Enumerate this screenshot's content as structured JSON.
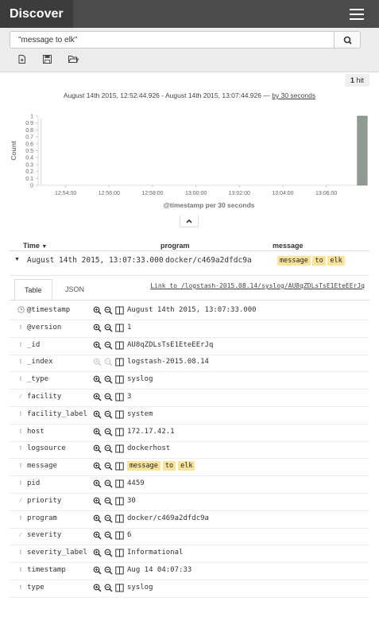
{
  "header": {
    "title": "Discover"
  },
  "search": {
    "value": "\"message to elk\""
  },
  "hits": {
    "count": "1",
    "label": "hit"
  },
  "chart_header": {
    "range": "August 14th 2015, 12:52:44.926 - August 14th 2015, 13:07:44.926",
    "sep": "—",
    "interval": "by 30 seconds"
  },
  "chart_data": {
    "type": "bar",
    "ylabel": "Count",
    "xlabel": "@timestamp per 30 seconds",
    "yticks": [
      "0",
      "0.1",
      "0.2",
      "0.3",
      "0.4",
      "0.5",
      "0.6",
      "0.7",
      "0.8",
      "0.9",
      "1"
    ],
    "ylim": [
      0,
      1
    ],
    "xticks": [
      "12:54:00",
      "12:56:00",
      "12:58:00",
      "13:00:00",
      "13:02:00",
      "13:04:00",
      "13:06:00"
    ],
    "series": [
      {
        "x": [
          "13:07:30"
        ],
        "values": [
          1
        ]
      }
    ]
  },
  "table": {
    "columns": [
      "Time",
      "program",
      "message"
    ],
    "row": {
      "time": "August 14th 2015, 13:07:33.000",
      "program": "docker/c469a2dfdc9a",
      "message": [
        "message",
        "to",
        "elk"
      ]
    }
  },
  "details": {
    "tabs": [
      "Table",
      "JSON"
    ],
    "link": "Link to /logstash-2015.08.14/syslog/AU8qZDLsTsE1EteEErJq",
    "fields": [
      {
        "type": "clock",
        "name": "@timestamp",
        "value": "August 14th 2015, 13:07:33.000"
      },
      {
        "type": "t",
        "name": "@version",
        "value": "1"
      },
      {
        "type": "t",
        "name": "_id",
        "value": "AU8qZDLsTsE1EteEErJq"
      },
      {
        "type": "t",
        "name": "_index",
        "value": "logstash-2015.08.14"
      },
      {
        "type": "t",
        "name": "_type",
        "value": "syslog"
      },
      {
        "type": "#",
        "name": "facility",
        "value": "3"
      },
      {
        "type": "t",
        "name": "facility_label",
        "value": "system"
      },
      {
        "type": "t",
        "name": "host",
        "value": "172.17.42.1"
      },
      {
        "type": "t",
        "name": "logsource",
        "value": "dockerhost"
      },
      {
        "type": "t",
        "name": "message",
        "value": [
          "message",
          "to",
          "elk"
        ]
      },
      {
        "type": "t",
        "name": "pid",
        "value": "4459"
      },
      {
        "type": "#",
        "name": "priority",
        "value": "30"
      },
      {
        "type": "t",
        "name": "program",
        "value": "docker/c469a2dfdc9a"
      },
      {
        "type": "#",
        "name": "severity",
        "value": "6"
      },
      {
        "type": "t",
        "name": "severity_label",
        "value": "Informational"
      },
      {
        "type": "t",
        "name": "timestamp",
        "value": "Aug 14 04:07:33"
      },
      {
        "type": "t",
        "name": "type",
        "value": "syslog"
      }
    ]
  }
}
